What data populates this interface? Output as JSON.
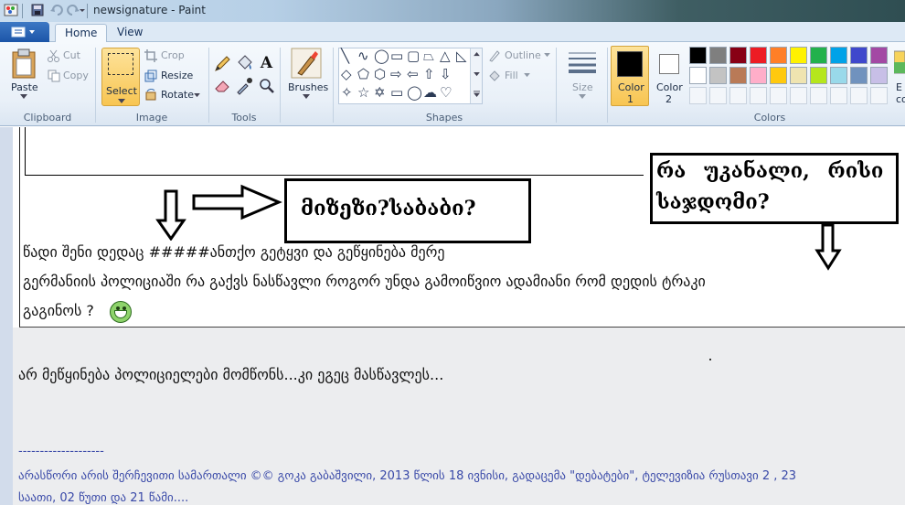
{
  "window": {
    "title": "newsignature - Paint"
  },
  "tabs": [
    {
      "label": "Home"
    },
    {
      "label": "View"
    }
  ],
  "ribbon": {
    "clipboard": {
      "paste": "Paste",
      "cut": "Cut",
      "copy": "Copy",
      "group": "Clipboard"
    },
    "image": {
      "select": "Select",
      "crop": "Crop",
      "resize": "Resize",
      "rotate": "Rotate",
      "group": "Image"
    },
    "tools": {
      "group": "Tools"
    },
    "brushes": {
      "label": "Brushes"
    },
    "shapes": {
      "outline": "Outline",
      "fill": "Fill",
      "group": "Shapes"
    },
    "size": {
      "label": "Size"
    },
    "colors": {
      "color1": "Color",
      "color1_num": "1",
      "color2": "Color",
      "color2_num": "2",
      "edit": "E",
      "edit2": "co",
      "group": "Colors"
    },
    "palette_row1": [
      "#000000",
      "#7f7f7f",
      "#880015",
      "#ed1c24",
      "#ff7f27",
      "#fff200",
      "#22b14c",
      "#00a2e8",
      "#3f48cc",
      "#a349a4"
    ],
    "palette_row2": [
      "#ffffff",
      "#c3c3c3",
      "#b97a57",
      "#ffaec9",
      "#ffc90e",
      "#efe4b0",
      "#b5e61d",
      "#99d9ea",
      "#7092be",
      "#c8bfe7"
    ]
  },
  "canvas": {
    "box1": "მიზეზი?საბაბი?",
    "box2_line1": "რა უკანალი, რისი",
    "box2_line2": "საჯდომი?",
    "line1": "წადი შენი დედაც #####ანთქო გეტყვი და გეწყინება მერე",
    "line2": "გერმანიის პოლიციაში რა გაქვს ნასწავლი როგორ უნდა გამოიწვიო ადამიანი რომ დედის ტრაკი",
    "line3": "გაგინოს ?"
  },
  "page": {
    "reply": "არ მეწყინება პოლიციელები მომწონს...კი ეგეც მასწავლეს...",
    "dashes": "--------------------",
    "sig1": "არასწორი არის შერჩევითი სამართალი ©© გოკა გაბაშვილი, 2013 წლის 18 ივნისი, გადაცემა \"დებატები\", ტელევიზია რუსთავი 2 , 23",
    "sig2": "საათი, 02 წუთი და 21 წამი...."
  }
}
